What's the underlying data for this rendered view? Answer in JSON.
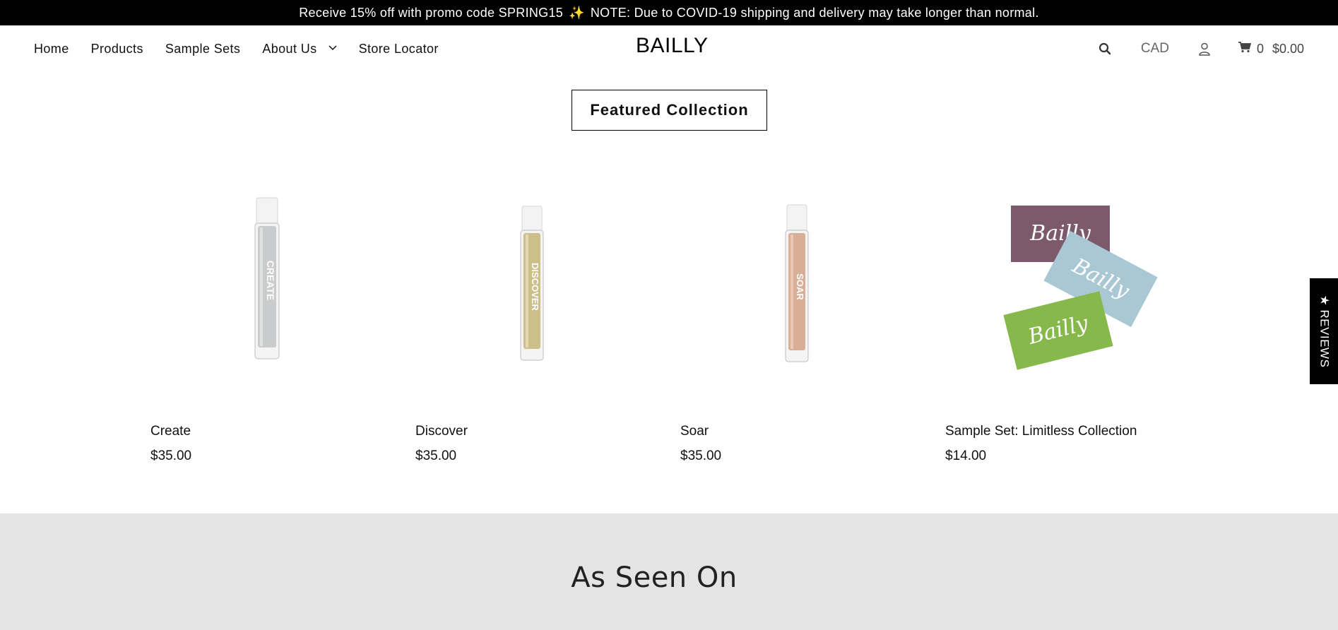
{
  "announcement": {
    "text_before": "Receive 15% off with promo code SPRING15",
    "sparkle": "✨",
    "text_after": "NOTE: Due to COVID-19 shipping and delivery may take longer than normal."
  },
  "nav": {
    "items": [
      {
        "label": "Home"
      },
      {
        "label": "Products"
      },
      {
        "label": "Sample Sets"
      },
      {
        "label": "About Us"
      },
      {
        "label": "Store Locator"
      }
    ]
  },
  "brand": {
    "logo_text": "BAILLY"
  },
  "header_tools": {
    "search_icon": "search-icon",
    "currency": "CAD",
    "account_icon": "user-icon",
    "cart_icon": "cart-icon",
    "cart_count": "0",
    "cart_total": "$0.00"
  },
  "featured": {
    "title": "Featured Collection",
    "products": [
      {
        "name": "Create",
        "price": "$35.00",
        "bottle_label": "CREATE",
        "liquid_color": "#c9cbcc"
      },
      {
        "name": "Discover",
        "price": "$35.00",
        "bottle_label": "DISCOVER",
        "liquid_color": "#cdbf8a"
      },
      {
        "name": "Soar",
        "price": "$35.00",
        "bottle_label": "SOAR",
        "liquid_color": "#d9ae96"
      },
      {
        "name": "Sample Set: Limitless Collection",
        "price": "$14.00",
        "card_brand": "Bailly",
        "card_colors": [
          "#7d5a6b",
          "#a9c8d4",
          "#86b84c"
        ]
      }
    ]
  },
  "reviews_tab": {
    "label": "★ REVIEWS"
  },
  "as_seen_on": {
    "title": "As Seen On"
  }
}
